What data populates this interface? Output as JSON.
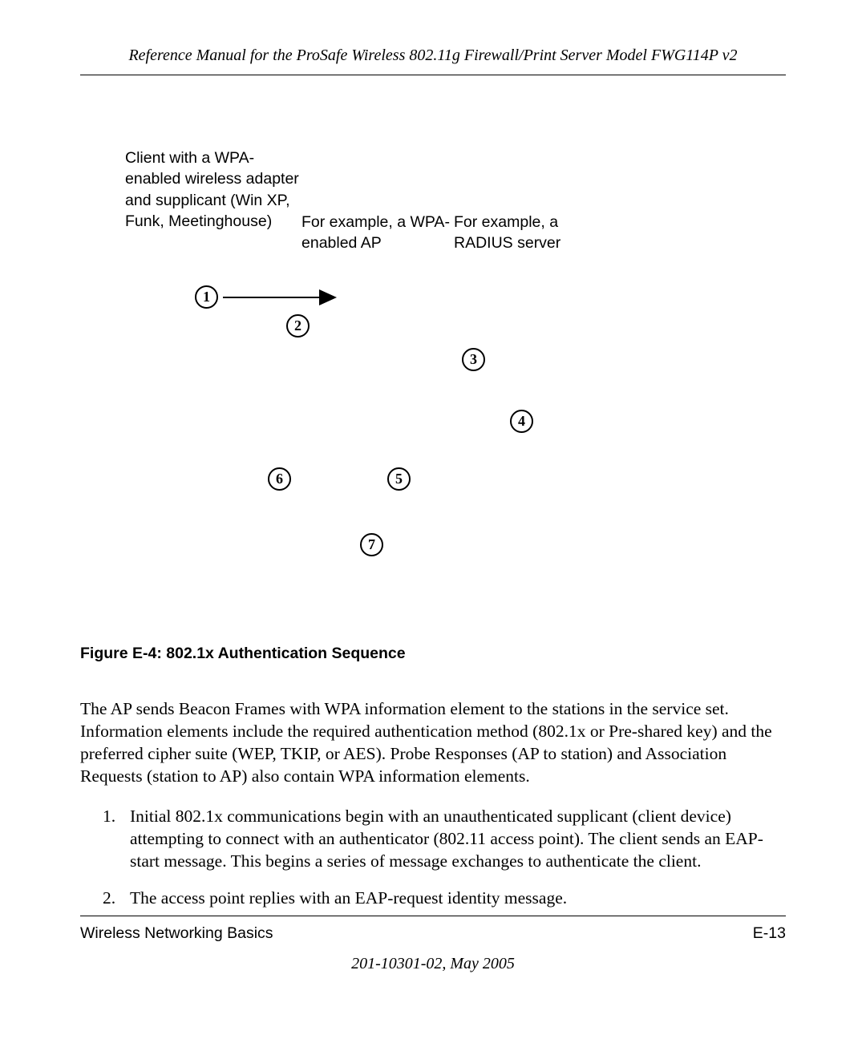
{
  "header": "Reference Manual for the ProSafe Wireless 802.11g  Firewall/Print Server Model FWG114P v2",
  "diagram": {
    "labels": {
      "client": "Client with a WPA-enabled wireless adapter and supplicant (Win XP, Funk, Meetinghouse)",
      "ap": "For example, a WPA-enabled AP",
      "radius": "For example, a RADIUS server"
    },
    "circles": {
      "c1": "1",
      "c2": "2",
      "c3": "3",
      "c4": "4",
      "c5": "5",
      "c6": "6",
      "c7": "7"
    }
  },
  "figure_caption": "Figure E-4:  802.1x Authentication Sequence",
  "body_paragraph": "The AP sends Beacon Frames with WPA information element to the stations in the service set. Information elements include the required authentication method (802.1x or Pre-shared key) and the preferred cipher suite (WEP, TKIP, or AES). Probe Responses (AP to station) and Association Requests (station to AP) also contain WPA information elements.",
  "list": {
    "item1": {
      "num": "1.",
      "text": "Initial 802.1x communications begin with an unauthenticated supplicant (client device) attempting to connect with an authenticator (802.11 access point). The client sends an EAP-start message. This begins a series of message exchanges to authenticate the client."
    },
    "item2": {
      "num": "2.",
      "text": "The access point replies with an EAP-request identity message."
    }
  },
  "footer": {
    "left": "Wireless Networking Basics",
    "right": "E-13",
    "doc_id": "201-10301-02, May 2005"
  }
}
